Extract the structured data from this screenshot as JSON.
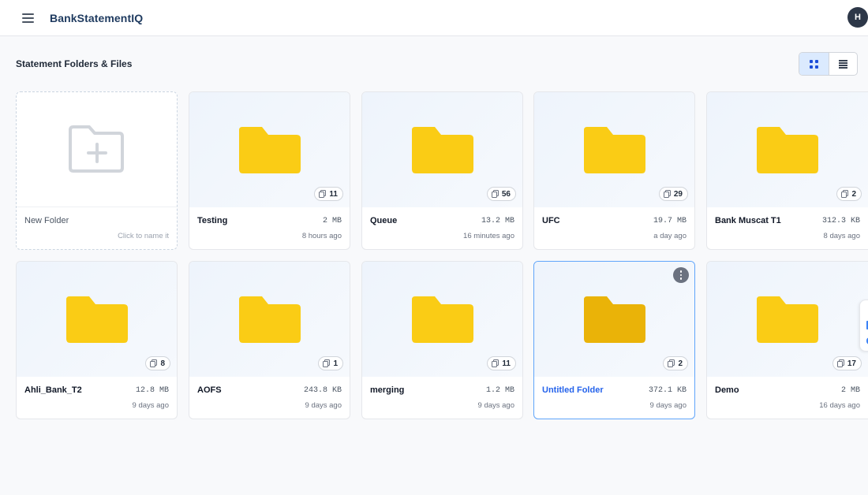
{
  "app": {
    "title": "BankStatementIQ",
    "user_initial": "H"
  },
  "main": {
    "section_title": "Statement Folders & Files",
    "view_modes": [
      {
        "name": "grid",
        "active": true
      },
      {
        "name": "list",
        "active": false
      }
    ]
  },
  "new_folder": {
    "name": "New Folder",
    "hint": "Click to name it"
  },
  "folders": [
    {
      "name": "Testing",
      "size": "2 MB",
      "time": "8 hours ago",
      "count": "11"
    },
    {
      "name": "Queue",
      "size": "13.2 MB",
      "time": "16 minutes ago",
      "count": "56"
    },
    {
      "name": "UFC",
      "size": "19.7 MB",
      "time": "a day ago",
      "count": "29"
    },
    {
      "name": "Bank Muscat T1",
      "size": "312.3 KB",
      "time": "8 days ago",
      "count": "2"
    },
    {
      "name": "Ahli_Bank_T2",
      "size": "12.8 MB",
      "time": "9 days ago",
      "count": "8"
    },
    {
      "name": "AOFS",
      "size": "243.8 KB",
      "time": "9 days ago",
      "count": "1"
    },
    {
      "name": "merging",
      "size": "1.2 MB",
      "time": "9 days ago",
      "count": "11"
    },
    {
      "name": "Untitled Folder",
      "size": "372.1 KB",
      "time": "9 days ago",
      "count": "2"
    },
    {
      "name": "Demo",
      "size": "2 MB",
      "time": "16 days ago",
      "count": "17"
    }
  ],
  "colors": {
    "brand": "#1e3a5f",
    "folder": "#facc15",
    "folder_selected": "#eab308",
    "accent": "#2563eb"
  },
  "icons": {
    "menu": "hamburger-menu-icon",
    "new_folder": "folder-plus-icon",
    "folder": "folder-icon",
    "file_count": "document-icon",
    "more": "more-vertical-icon"
  }
}
